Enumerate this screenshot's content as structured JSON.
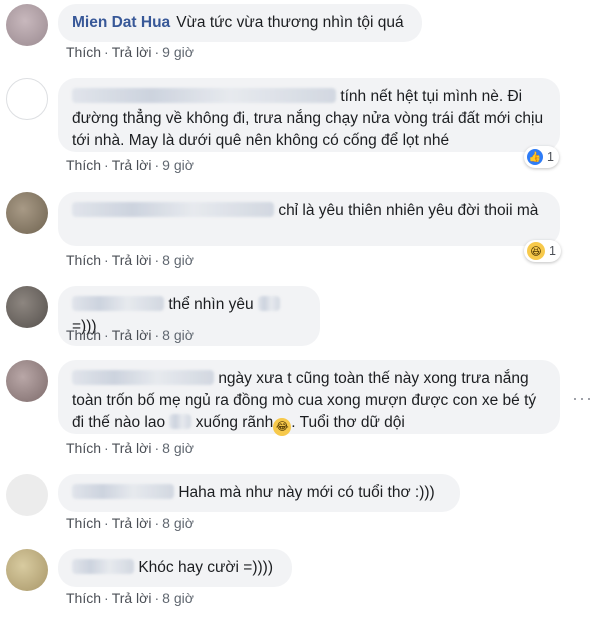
{
  "actions": {
    "like": "Thích",
    "reply": "Trả lời",
    "dot": "·"
  },
  "comments": [
    {
      "author": "Mien Dat Hua",
      "text": "Vừa tức vừa thương nhìn tội quá",
      "time": "9 giờ"
    },
    {
      "text": "tính nết hệt tụi mình nè. Đi đường thẳng về không đi, trưa nắng chạy nửa vòng trái đất mới chịu tới nhà. May là dưới quê nên không có cống để lọt nhé",
      "time": "9 giờ",
      "reactions": {
        "icon": "like-icon",
        "count": "1"
      }
    },
    {
      "text": "chỉ là yêu thiên nhiên yêu đời thoii mà",
      "time": "8 giờ",
      "reactions": {
        "icon": "haha-icon",
        "count": "1"
      }
    },
    {
      "text_a": "thể nhìn yêu",
      "text_b": "=)))",
      "time": "8 giờ"
    },
    {
      "text_a": "ngày xưa t cũng toàn thế này xong trưa nắng toàn trốn bố mẹ ngủ ra đồng mò cua xong mượn được con xe bé tý đi thế nào lao",
      "text_b": "xuống rãnh",
      "text_c": ". Tuổi thơ dữ dội",
      "time": "8 giờ"
    },
    {
      "text": "Haha mà như này mới có tuổi thơ :)))",
      "time": "8 giờ"
    },
    {
      "text": "Khóc hay cười =))))",
      "time": "8 giờ"
    }
  ],
  "more_glyph": "···",
  "colors": {
    "author": "#385898",
    "bubble": "#f2f3f5",
    "meta": "#606770",
    "like": "#2e7cf6",
    "haha": "#f7c94b"
  }
}
